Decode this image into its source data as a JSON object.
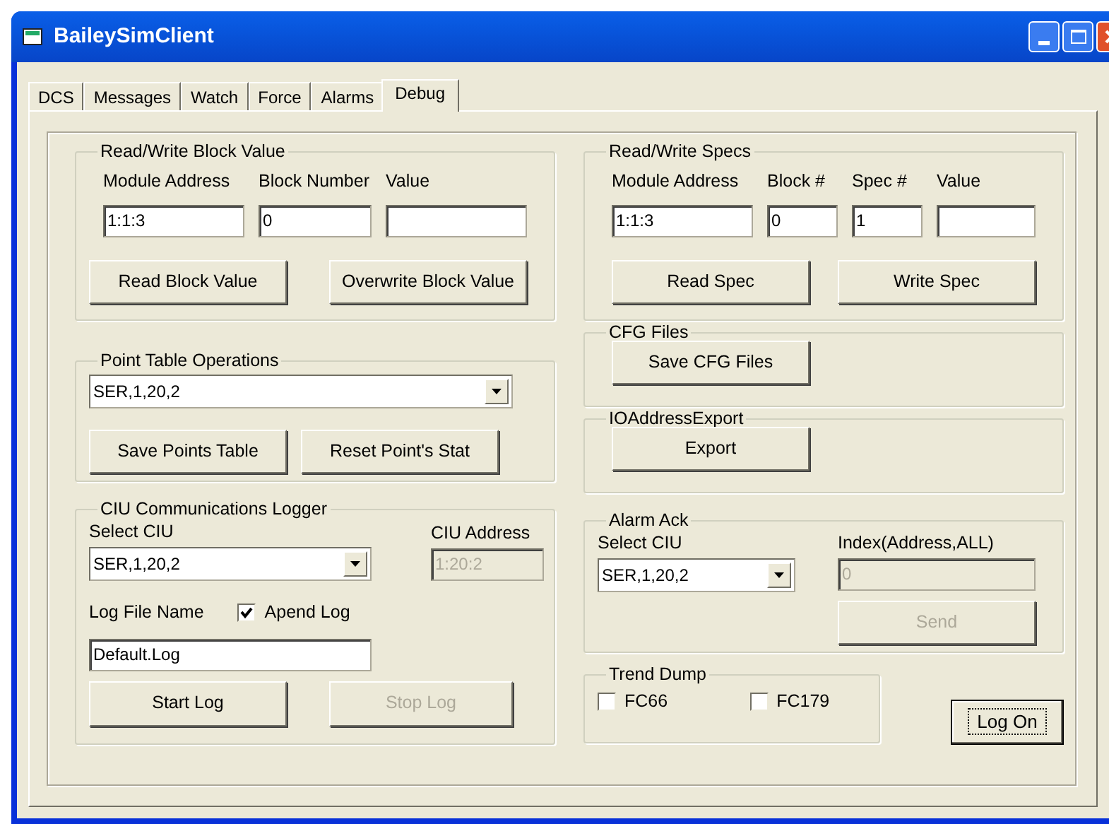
{
  "window": {
    "title": "BaileySimClient"
  },
  "tabs": [
    {
      "label": "DCS",
      "selected": false
    },
    {
      "label": "Messages",
      "selected": false
    },
    {
      "label": "Watch",
      "selected": false
    },
    {
      "label": "Force",
      "selected": false
    },
    {
      "label": "Alarms",
      "selected": false
    },
    {
      "label": "Debug",
      "selected": true
    }
  ],
  "read_write_block": {
    "title": "Read/Write Block Value",
    "fields": [
      {
        "label": "Module Address",
        "value": "1:1:3"
      },
      {
        "label": "Block Number",
        "value": "0"
      },
      {
        "label": "Value"
      }
    ],
    "buttons": [
      {
        "label": "Read Block Value",
        "disabled": false
      },
      {
        "label": "Overwrite Block Value",
        "disabled": false
      }
    ]
  },
  "point_table": {
    "title": "Point Table Operations",
    "combo": {
      "value": "SER,1,20,2"
    },
    "buttons": [
      {
        "label": "Save Points Table",
        "disabled": false
      },
      {
        "label": "Reset Point's Stat",
        "disabled": false
      }
    ]
  },
  "ciu_logger": {
    "title": "CIU Communications Logger",
    "select_label": "Select CIU",
    "combo": {
      "value": "SER,1,20,2"
    },
    "address_label": "CIU Address",
    "address": {
      "value": "1:20:2",
      "disabled": true
    },
    "file_label": "Log File Name",
    "append": {
      "label": "Apend Log",
      "checked": true
    },
    "file": {
      "value": "Default.Log",
      "disabled": false
    },
    "buttons": [
      {
        "label": "Start Log",
        "disabled": false
      },
      {
        "label": "Stop Log",
        "disabled": true
      }
    ]
  },
  "read_write_specs": {
    "title": "Read/Write Specs",
    "fields": [
      {
        "label": "Module Address",
        "value": "1:1:3"
      },
      {
        "label": "Block #",
        "value": "0"
      },
      {
        "label": "Spec #",
        "value": "1"
      },
      {
        "label": "Value"
      }
    ],
    "buttons": [
      {
        "label": "Read Spec",
        "disabled": false
      },
      {
        "label": "Write Spec",
        "disabled": false
      }
    ]
  },
  "cfg_files": {
    "title": "CFG Files",
    "button": {
      "label": "Save CFG Files",
      "disabled": false
    }
  },
  "io_address_export": {
    "title": "IOAddressExport",
    "button": {
      "label": "Export",
      "disabled": false
    }
  },
  "alarm_ack": {
    "title": "Alarm Ack",
    "select_label": "Select CIU",
    "combo": {
      "value": "SER,1,20,2"
    },
    "index_label": "Index(Address,ALL)",
    "index": {
      "value": "0",
      "disabled": true
    },
    "button": {
      "label": "Send",
      "disabled": true
    }
  },
  "trend_dump": {
    "title": "Trend Dump",
    "checkboxes": [
      {
        "label": "FC66",
        "checked": false
      },
      {
        "label": "FC179",
        "checked": false
      }
    ]
  },
  "log_on": {
    "label": "Log On",
    "focused": true,
    "disabled": false
  }
}
